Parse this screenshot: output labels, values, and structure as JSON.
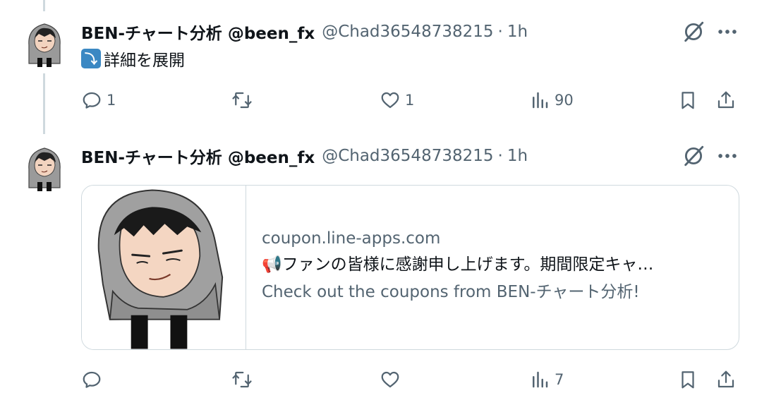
{
  "colors": {
    "text": "#0f1419",
    "muted": "#536471",
    "border": "#cfd9de",
    "link_emoji_bg": "#3b88c3"
  },
  "tweets": [
    {
      "author_name": "BEN-チャート分析 @been_fx",
      "handle": "@Chad36548738215",
      "separator": "·",
      "time": "1h",
      "text_emoji": "⤵",
      "text": "詳細を展開",
      "actions": {
        "reply": "1",
        "retweet": "",
        "like": "1",
        "views": "90"
      }
    },
    {
      "author_name": "BEN-チャート分析 @been_fx",
      "handle": "@Chad36548738215",
      "separator": "·",
      "time": "1h",
      "card": {
        "domain": "coupon.line-apps.com",
        "title": "📢ファンの皆様に感謝申し上げます。期間限定キャ…",
        "description": "Check out the coupons from BEN-チャート分析!"
      },
      "actions": {
        "reply": "",
        "retweet": "",
        "like": "",
        "views": "7"
      }
    }
  ],
  "icons": {
    "avatar": "hooded-character-avatar",
    "grok": "grok-icon",
    "more": "more-dots-icon",
    "reply": "reply-icon",
    "retweet": "retweet-icon",
    "like": "heart-icon",
    "views": "views-chart-icon",
    "bookmark": "bookmark-icon",
    "share": "share-icon"
  }
}
